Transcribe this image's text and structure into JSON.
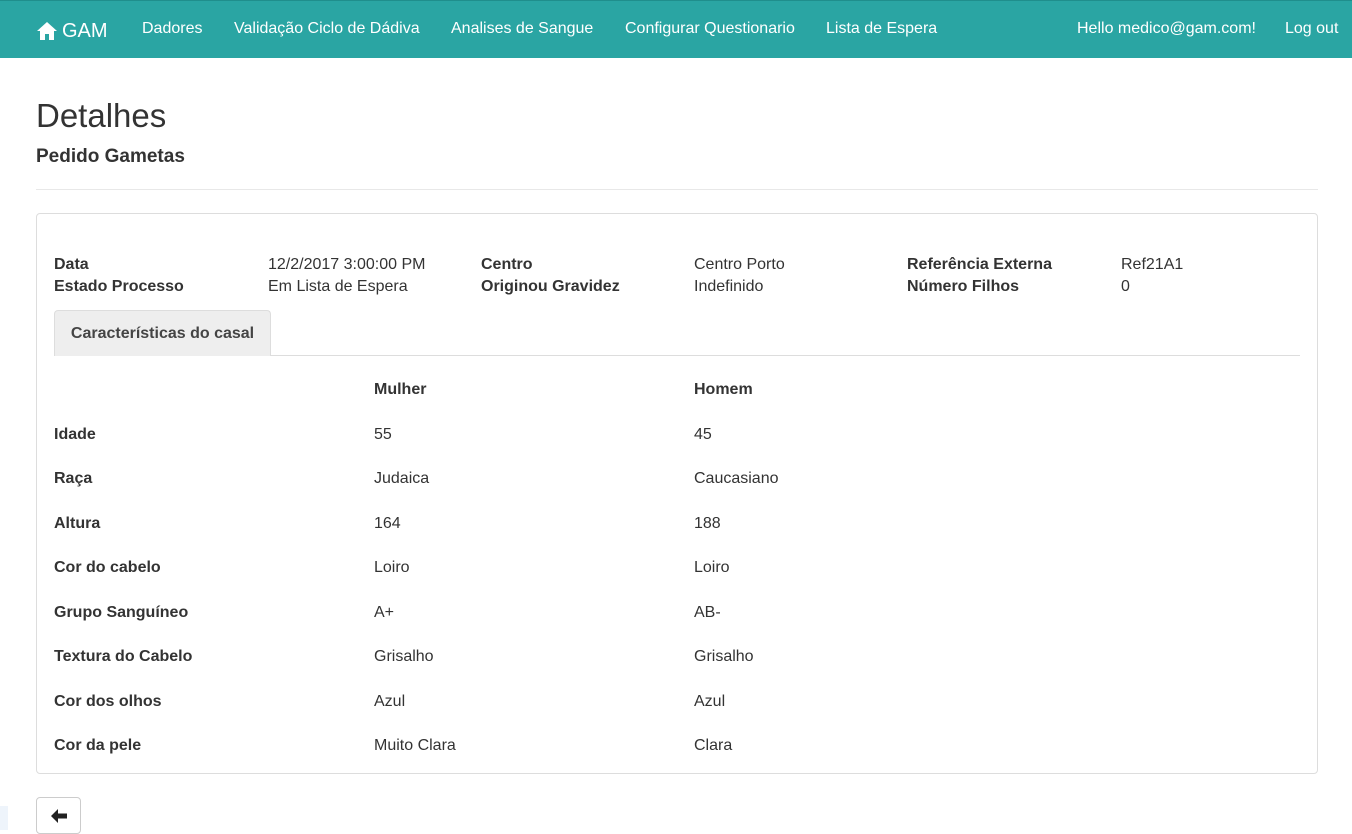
{
  "nav": {
    "brand": "GAM",
    "items": [
      "Dadores",
      "Validação Ciclo de Dádiva",
      "Analises de Sangue",
      "Configurar Questionario",
      "Lista de Espera"
    ],
    "greeting": "Hello medico@gam.com!",
    "logout": "Log out",
    "background_color": "#2aa5a3"
  },
  "header": {
    "title": "Detalhes",
    "subtitle": "Pedido Gametas"
  },
  "details": {
    "data_label": "Data",
    "data_value": "12/2/2017 3:00:00 PM",
    "centro_label": "Centro",
    "centro_value": "Centro Porto",
    "referencia_label": "Referência Externa",
    "referencia_value": "Ref21A1",
    "estado_label": "Estado Processo",
    "estado_value": "Em Lista de Espera",
    "gravidez_label": "Originou Gravidez",
    "gravidez_value": "Indefinido",
    "filhos_label": "Número Filhos",
    "filhos_value": "0"
  },
  "tab": {
    "label": "Características do casal"
  },
  "table": {
    "headers": [
      "Mulher",
      "Homem"
    ],
    "rows": [
      {
        "label": "Idade",
        "mulher": "55",
        "homem": "45"
      },
      {
        "label": "Raça",
        "mulher": "Judaica",
        "homem": "Caucasiano"
      },
      {
        "label": "Altura",
        "mulher": "164",
        "homem": "188"
      },
      {
        "label": "Cor do cabelo",
        "mulher": "Loiro",
        "homem": "Loiro"
      },
      {
        "label": "Grupo Sanguíneo",
        "mulher": "A+",
        "homem": "AB-"
      },
      {
        "label": "Textura do Cabelo",
        "mulher": "Grisalho",
        "homem": "Grisalho"
      },
      {
        "label": "Cor dos olhos",
        "mulher": "Azul",
        "homem": "Azul"
      },
      {
        "label": "Cor da pele",
        "mulher": "Muito Clara",
        "homem": "Clara"
      }
    ]
  },
  "icons": {
    "brand_icon": "home-icon",
    "back_icon": "arrow-left-icon"
  }
}
